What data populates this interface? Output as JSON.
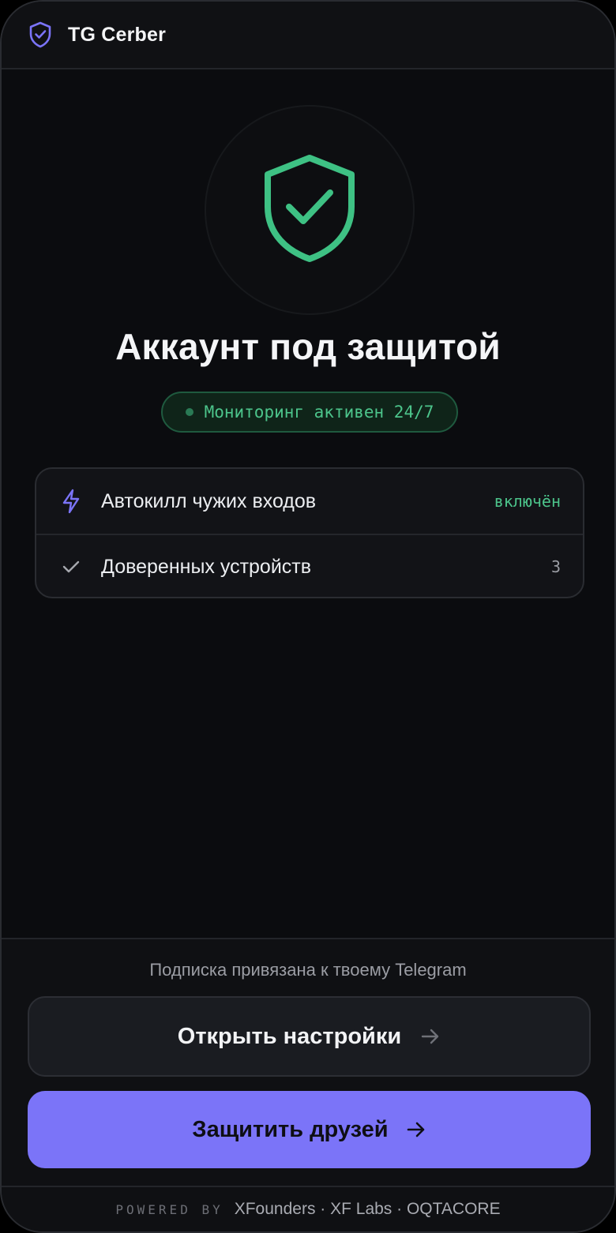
{
  "header": {
    "title": "TG Cerber",
    "logo_icon": "shield-check-icon"
  },
  "hero": {
    "icon": "shield-check-icon",
    "title": "Аккаунт под защитой",
    "status": "Мониторинг активен 24/7"
  },
  "info": {
    "items": [
      {
        "icon": "lightning-icon",
        "label": "Автокилл чужих входов",
        "value": "включён"
      },
      {
        "icon": "check-icon",
        "label": "Доверенных устройств",
        "value": "3"
      }
    ]
  },
  "bottom": {
    "note": "Подписка привязана к твоему Telegram",
    "settings_button": "Открыть настройки",
    "friends_button": "Защитить друзей"
  },
  "footer": {
    "powered_by": "POWERED BY",
    "credits": "XFounders · XF Labs · OQTACORE"
  },
  "colors": {
    "accent": "#7b74f8",
    "success": "#4cc48b",
    "background": "#0b0c0f"
  }
}
